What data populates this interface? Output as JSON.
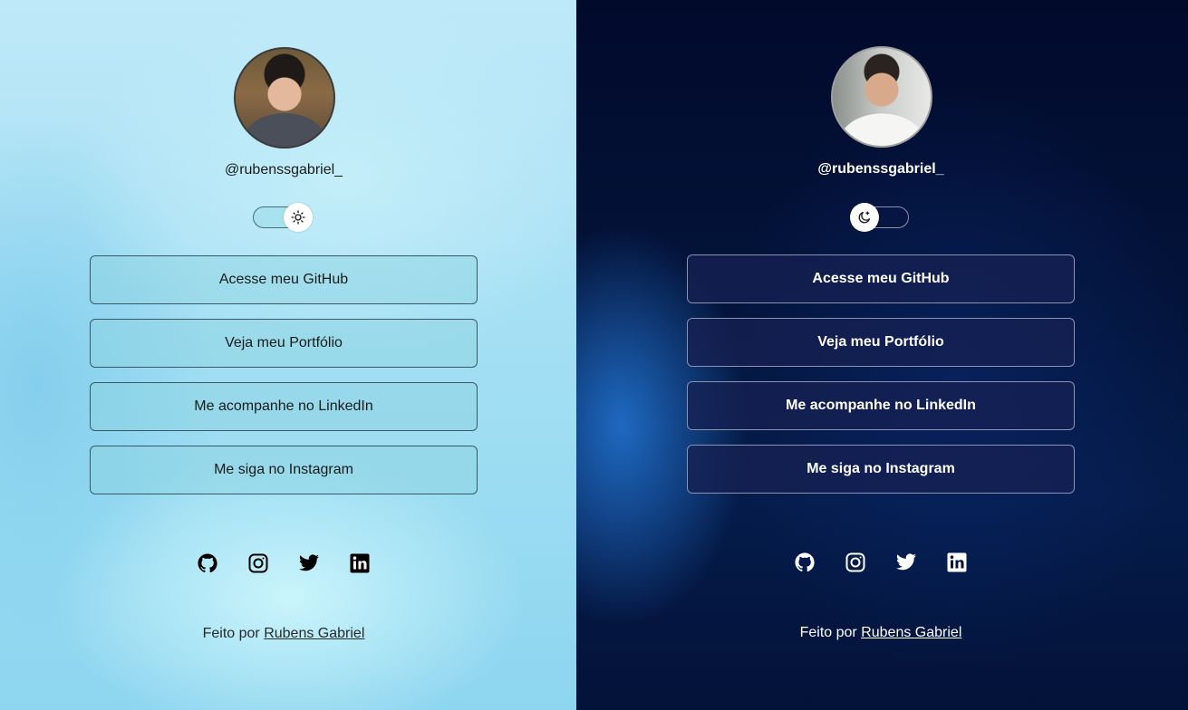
{
  "themes": {
    "light": {
      "username": "@rubenssgabriel_",
      "toggle_icon": "sun-icon",
      "buttons": [
        "Acesse meu GitHub",
        "Veja meu Portfólio",
        "Me acompanhe no LinkedIn",
        "Me siga no Instagram"
      ],
      "footer_prefix": "Feito por",
      "footer_link": "Rubens Gabriel",
      "accent": "#9adcf2"
    },
    "dark": {
      "username": "@rubenssgabriel_",
      "toggle_icon": "moon-icon",
      "buttons": [
        "Acesse meu GitHub",
        "Veja meu Portfólio",
        "Me acompanhe no LinkedIn",
        "Me siga no Instagram"
      ],
      "footer_prefix": "Feito por",
      "footer_link": "Rubens Gabriel",
      "accent": "#031339"
    }
  },
  "social_icons": [
    "github-icon",
    "instagram-icon",
    "twitter-icon",
    "linkedin-icon"
  ]
}
